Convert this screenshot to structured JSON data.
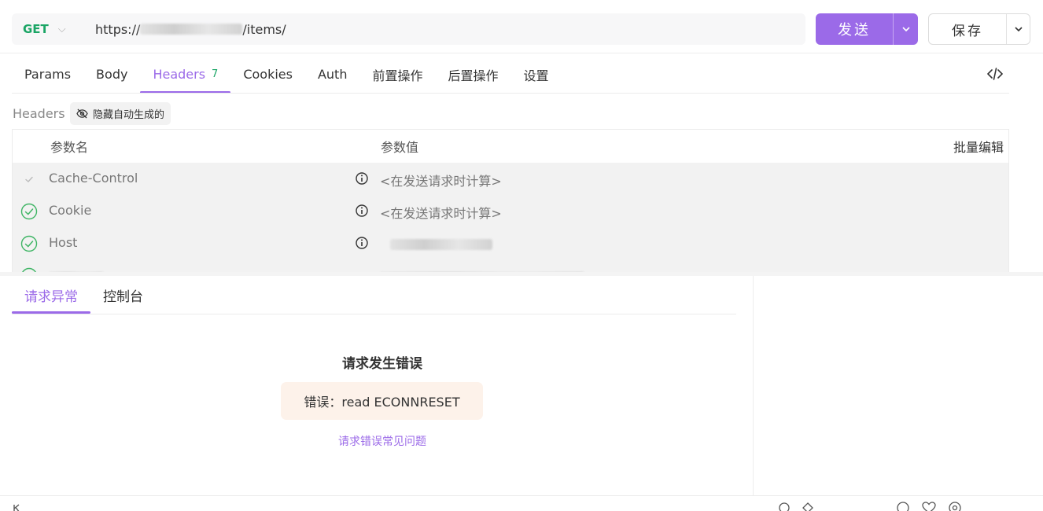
{
  "request": {
    "method": "GET",
    "url_prefix": "https://",
    "url_suffix": "/items/"
  },
  "actions": {
    "send_label": "发送",
    "save_label": "保存"
  },
  "tabs": [
    {
      "label": "Params"
    },
    {
      "label": "Body"
    },
    {
      "label": "Headers",
      "count": "7"
    },
    {
      "label": "Cookies"
    },
    {
      "label": "Auth"
    },
    {
      "label": "前置操作"
    },
    {
      "label": "后置操作"
    },
    {
      "label": "设置"
    }
  ],
  "headers_section": {
    "label": "Headers",
    "hide_auto_label": "隐藏自动生成的",
    "col_name": "参数名",
    "col_value": "参数值",
    "bulk_edit": "批量编辑",
    "rows": [
      {
        "name": "Cache-Control",
        "value": "<在发送请求时计算>"
      },
      {
        "name": "Cookie",
        "value": "<在发送请求时计算>"
      },
      {
        "name": "Host",
        "value": ""
      }
    ]
  },
  "bottom_tabs": [
    {
      "label": "请求异常"
    },
    {
      "label": "控制台"
    }
  ],
  "error": {
    "title": "请求发生错误",
    "message": "错误：read ECONNRESET",
    "link": "请求错误常见问题"
  },
  "colors": {
    "accent": "#9b6ae8",
    "method": "#1aa565",
    "success": "#3fb565"
  }
}
